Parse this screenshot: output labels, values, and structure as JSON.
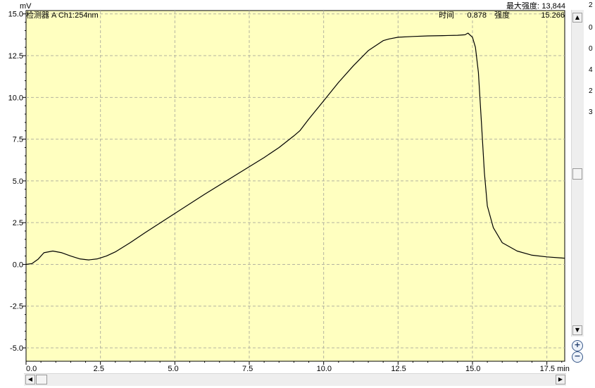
{
  "header": {
    "unit_label": "mV",
    "detector_label": "检测器 A Ch1:254nm",
    "max_intensity_label": "最大强度:",
    "max_intensity_value": "13,844",
    "time_label": "时间",
    "time_value": "0.878",
    "intensity_label": "强度",
    "intensity_value": "15.266"
  },
  "controls": {
    "scroll_up": "▲",
    "scroll_down": "▼",
    "scroll_left": "◀",
    "scroll_right": "▶",
    "zoom_in": "+",
    "zoom_out": "−"
  },
  "clipped_chars": [
    "2",
    "0",
    "0",
    "4",
    "2",
    "3"
  ],
  "chart_data": {
    "type": "line",
    "xlabel": "min",
    "ylabel": "mV",
    "xlim": [
      0,
      18.1
    ],
    "ylim": [
      -5.8,
      15.2
    ],
    "x_ticks": [
      0,
      2.5,
      5,
      7.5,
      10,
      12.5,
      15,
      17.5
    ],
    "x_tick_labels": [
      "0.0",
      "2.5",
      "5.0",
      "7.5",
      "10.0",
      "12.5",
      "15.0",
      "17.5 min"
    ],
    "y_ticks": [
      -5,
      -2.5,
      0,
      2.5,
      5,
      7.5,
      10,
      12.5,
      15
    ],
    "y_tick_labels": [
      "-5.0",
      "-2.5",
      "0.0",
      "2.5",
      "5.0",
      "7.5",
      "10.0",
      "12.5",
      "15.0"
    ],
    "grid": true,
    "colors": {
      "plot_bg": "#ffffc0",
      "line": "#000000",
      "grid": "#b4b4a0"
    },
    "series": [
      {
        "x": [
          0,
          0.2,
          0.4,
          0.6,
          0.9,
          1.2,
          1.5,
          1.8,
          2.1,
          2.4,
          2.7,
          3.0,
          3.5,
          4.0,
          5.0,
          6.0,
          7.0,
          8.0,
          8.5,
          9.0,
          9.2,
          9.5,
          10.0,
          10.5,
          11.0,
          11.5,
          12.0,
          12.2,
          12.5,
          13.0,
          13.5,
          14.0,
          14.5,
          14.75,
          14.85,
          15.0,
          15.1,
          15.2,
          15.3,
          15.4,
          15.5,
          15.7,
          16.0,
          16.5,
          17.0,
          17.5,
          18.0,
          18.1
        ],
        "y": [
          0.0,
          0.05,
          0.3,
          0.7,
          0.8,
          0.7,
          0.5,
          0.33,
          0.27,
          0.33,
          0.5,
          0.75,
          1.3,
          1.9,
          3.05,
          4.2,
          5.3,
          6.4,
          7.0,
          7.7,
          8.0,
          8.7,
          9.8,
          10.9,
          11.9,
          12.8,
          13.4,
          13.5,
          13.6,
          13.65,
          13.68,
          13.7,
          13.72,
          13.75,
          13.85,
          13.6,
          13.0,
          11.5,
          8.5,
          5.5,
          3.5,
          2.2,
          1.3,
          0.8,
          0.55,
          0.45,
          0.38,
          0.37
        ]
      }
    ]
  }
}
